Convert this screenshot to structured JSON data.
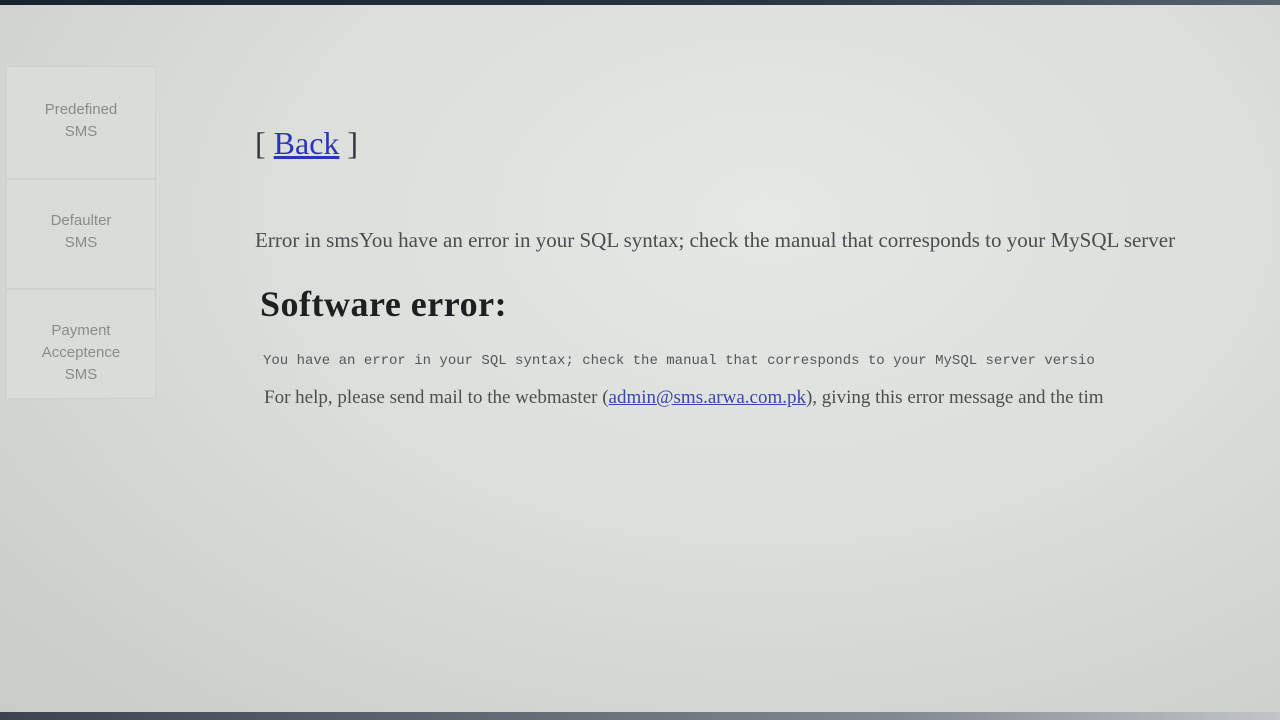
{
  "sidebar": {
    "items": [
      {
        "line1": "Predefined",
        "line2": "SMS",
        "line3": ""
      },
      {
        "line1": "Defaulter",
        "line2": "SMS",
        "line3": ""
      },
      {
        "line1": "Payment",
        "line2": "Acceptence",
        "line3": "SMS"
      }
    ]
  },
  "main": {
    "back_open": "[ ",
    "back_label": "Back",
    "back_close": " ]",
    "error_line": "Error in smsYou have an error in your SQL syntax; check the manual that corresponds to your MySQL server",
    "title": "Software error:",
    "mono_line": "You have an error in your SQL syntax; check the manual that corresponds to your MySQL server versio",
    "help_prefix": "For help, please send mail to the webmaster (",
    "help_email": "admin@sms.arwa.com.pk",
    "help_suffix": "), giving this error message and the tim"
  },
  "colors": {
    "link": "#2a36b8",
    "title": "#1e1f21",
    "background": "#dcdedc"
  }
}
